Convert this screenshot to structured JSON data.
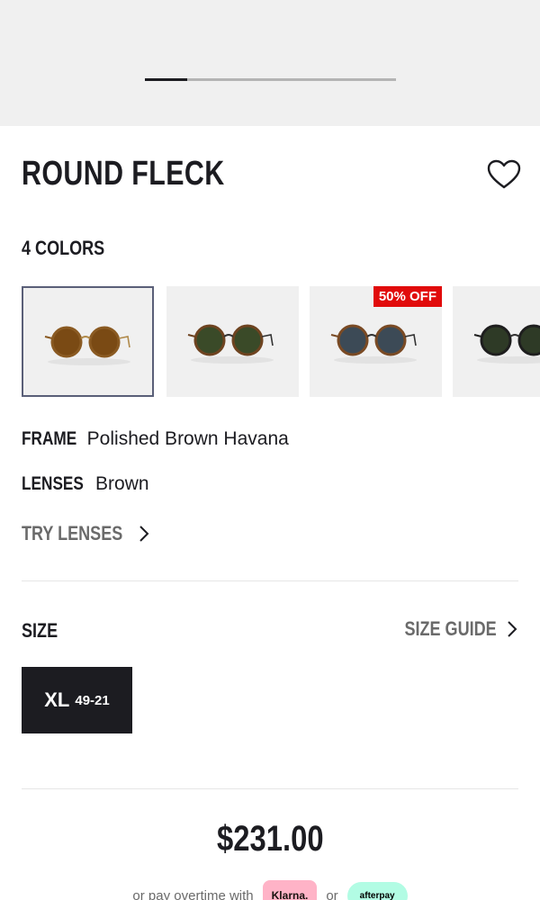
{
  "carousel": {
    "pages": 6,
    "active_index": 0
  },
  "product": {
    "title": "ROUND FLECK",
    "colors_label": "4 COLORS",
    "swatches": [
      {
        "name": "brown-lens-havana",
        "lens": "#7a4a14",
        "frame": "#8a5a22",
        "badge": ""
      },
      {
        "name": "green-lens-havana",
        "lens": "#3a4a28",
        "frame": "#6e4320",
        "badge": ""
      },
      {
        "name": "blue-lens-havana",
        "lens": "#3c4a56",
        "frame": "#7a4a24",
        "badge": "50% OFF"
      },
      {
        "name": "green-lens-black",
        "lens": "#2e3a26",
        "frame": "#1e1e1e",
        "badge": ""
      }
    ],
    "frame_label": "FRAME",
    "frame_value": "Polished Brown Havana",
    "lenses_label": "LENSES",
    "lenses_value": "Brown",
    "try_lenses": "TRY LENSES"
  },
  "size": {
    "label": "SIZE",
    "guide": "SIZE GUIDE",
    "option": "XL",
    "option_dims": "49-21"
  },
  "price": "$231.00",
  "payment": {
    "prefix": "or pay overtime with",
    "klarna": "Klarna.",
    "or": "or",
    "afterpay": "afterpay"
  },
  "colors": {
    "accent": "#1c1c21",
    "sale": "#e10b0b",
    "muted": "#6a6a6a"
  }
}
